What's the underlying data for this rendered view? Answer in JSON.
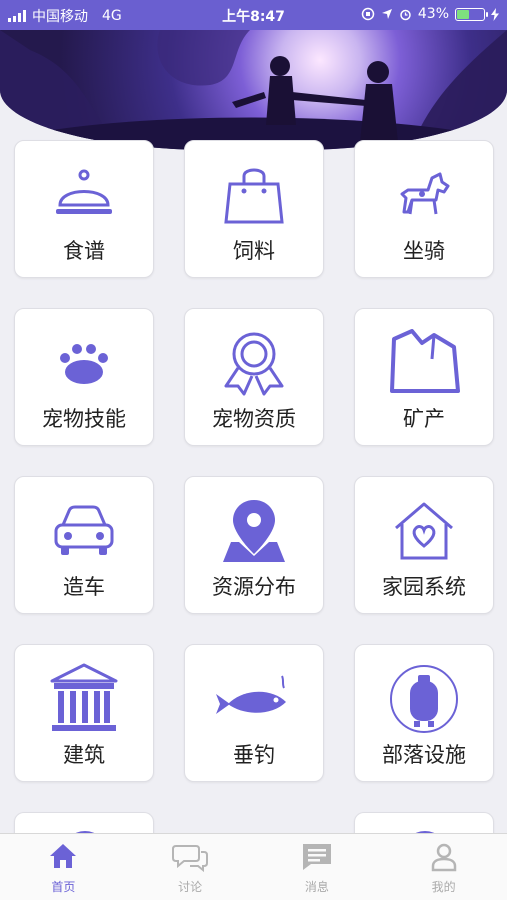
{
  "colors": {
    "accent": "#6b62d6",
    "status_bar": "#6a5fd0",
    "background": "#efeff4"
  },
  "status_bar": {
    "carrier": "中国移动",
    "network": "4G",
    "time": "上午8:47",
    "battery_percent": "43%",
    "battery_level": 0.43
  },
  "banner": {
    "image": "night-forest-couple-illustration"
  },
  "grid": {
    "items": [
      {
        "label": "食谱",
        "icon": "cloche-icon"
      },
      {
        "label": "饲料",
        "icon": "shopping-bag-icon"
      },
      {
        "label": "坐骑",
        "icon": "horse-icon"
      },
      {
        "label": "宠物技能",
        "icon": "paw-icon"
      },
      {
        "label": "宠物资质",
        "icon": "award-ribbon-icon"
      },
      {
        "label": "矿产",
        "icon": "rock-icon"
      },
      {
        "label": "造车",
        "icon": "car-icon"
      },
      {
        "label": "资源分布",
        "icon": "map-pin-icon"
      },
      {
        "label": "家园系统",
        "icon": "home-heart-icon"
      },
      {
        "label": "建筑",
        "icon": "temple-icon"
      },
      {
        "label": "垂钓",
        "icon": "fish-icon"
      },
      {
        "label": "部落设施",
        "icon": "barrel-icon"
      }
    ]
  },
  "tab_bar": {
    "tabs": [
      {
        "label": "首页",
        "icon": "home-icon",
        "active": true
      },
      {
        "label": "讨论",
        "icon": "chat-bubbles-icon",
        "active": false
      },
      {
        "label": "消息",
        "icon": "message-icon",
        "active": false
      },
      {
        "label": "我的",
        "icon": "user-icon",
        "active": false
      }
    ]
  }
}
